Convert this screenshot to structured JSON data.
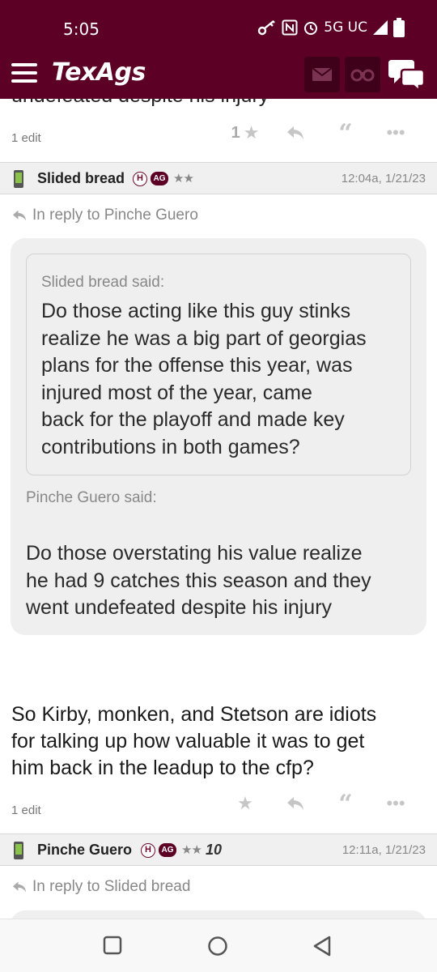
{
  "status_bar": {
    "time": "5:05",
    "network": "5G UC"
  },
  "header": {
    "logo": "TexAgs",
    "menu_icon": "hamburger-icon",
    "mail_icon": "mail-icon",
    "watch_icon": "binoculars-icon",
    "chat_icon": "chat-bubbles-icon"
  },
  "colors": {
    "brand": "#5d0025",
    "header_button": "#3f0019",
    "quote_bg": "#efefef"
  },
  "prev_post": {
    "cut_text": "undefeated despite his injury",
    "edit_label": "1 edit",
    "star_count": "1"
  },
  "post1": {
    "username": "Slided bread",
    "badge_h": "H",
    "badge_ag": "AG",
    "stars": "★★",
    "timestamp": "12:04a, 1/21/23",
    "reply_to": "In reply to Pinche Guero",
    "inner_quote": {
      "said": "Slided bread said:",
      "lines": [
        "Do those acting like this guy stinks",
        "realize he was a big part of georgias",
        "plans for the offense this year, was",
        "injured most of the year, came",
        "back for the playoff and made key",
        "contributions in both games?"
      ]
    },
    "outer_quote": {
      "said": "Pinche Guero said:",
      "lines": [
        "Do those overstating his value realize",
        "he had 9 catches this season and they",
        "went undefeated despite his injury"
      ]
    },
    "body_lines": [
      "So Kirby, monken, and Stetson are idiots",
      "for talking up how valuable it was to get",
      "him back in the leadup to the cfp?"
    ],
    "edit_label": "1 edit"
  },
  "post2": {
    "username": "Pinche Guero",
    "badge_h": "H",
    "badge_ag": "AG",
    "stars": "★★",
    "rank": "10",
    "timestamp": "12:11a, 1/21/23",
    "reply_to": "In reply to Slided bread"
  }
}
